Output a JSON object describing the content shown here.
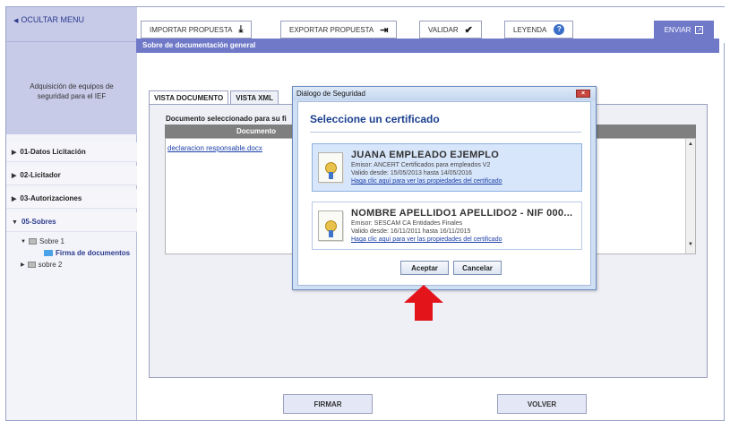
{
  "sidebar": {
    "hide_menu": "OCULTAR MENU",
    "procedure_title": "Adquisición de equipos de seguridad para el IEF",
    "items": [
      {
        "label": "01-Datos Licitación"
      },
      {
        "label": "02-Licitador"
      },
      {
        "label": "03-Autorizaciones"
      },
      {
        "label": "05-Sobres"
      }
    ],
    "tree": {
      "sobre1": "Sobre 1",
      "firma": "Firma de documentos",
      "sobre2": "sobre 2"
    }
  },
  "toolbar": {
    "import": "IMPORTAR PROPUESTA",
    "export": "EXPORTAR PROPUESTA",
    "validate": "VALIDAR",
    "legend": "LEYENDA",
    "send": "ENVIAR"
  },
  "main": {
    "section_title": "Sobre de documentación general",
    "tabs": [
      "VISTA DOCUMENTO",
      "VISTA XML"
    ],
    "doc_selected_label": "Documento seleccionado para su fi",
    "table_header": "Documento",
    "document_link": "declaracion responsable.docx",
    "buttons": {
      "sign": "FIRMAR",
      "back": "VOLVER"
    }
  },
  "dialog": {
    "title": "Diálogo de Seguridad",
    "heading": "Seleccione un certificado",
    "certificates": [
      {
        "name": "JUANA EMPLEADO EJEMPLO",
        "issuer": "Emisor: ANCERT Certificados para empleados V2",
        "validity": "Valido desde: 15/05/2013 hasta 14/05/2016",
        "link": "Haga clic aquí para ver las propiedades del certificado"
      },
      {
        "name": "NOMBRE APELLIDO1 APELLIDO2 - NIF 000...",
        "issuer": "Emisor: SESCAM CA Entidades Finales",
        "validity": "Valido desde: 16/11/2011 hasta 16/11/2015",
        "link": "Haga clic aquí para ver las propiedades del certificado"
      }
    ],
    "accept": "Aceptar",
    "cancel": "Cancelar"
  },
  "colors": {
    "accent": "#6f79c8",
    "sidebar_header": "#c7cbe8",
    "link": "#1b3ea8",
    "arrow": "#e3151b"
  },
  "icons": [
    "caret-left-icon",
    "caret-right-icon",
    "caret-down-icon",
    "folder-icon",
    "download-icon",
    "export-icon",
    "check-icon",
    "help-icon",
    "send-icon",
    "certificate-icon",
    "close-icon",
    "red-arrow-icon"
  ]
}
